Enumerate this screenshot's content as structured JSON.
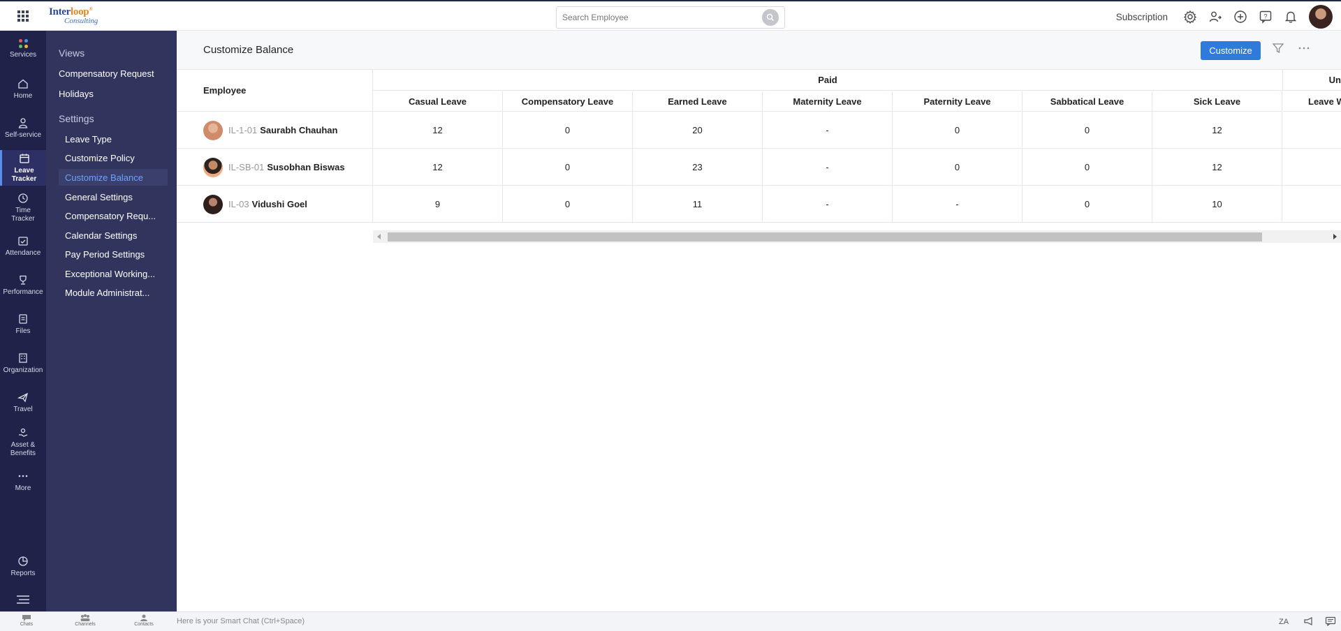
{
  "logo": {
    "line1_pre": "Inter",
    "line1_accent": "loop",
    "line1_mark": "®",
    "line2": "Consulting"
  },
  "search": {
    "placeholder": "Search Employee"
  },
  "topbar": {
    "subscription": "Subscription",
    "icons": [
      "settings-icon",
      "user-switch-icon",
      "add-icon",
      "help-icon",
      "bell-icon"
    ]
  },
  "rail": {
    "items": [
      {
        "label": "Services",
        "icon": "services-icon"
      },
      {
        "label": "Home",
        "icon": "home-icon"
      },
      {
        "label": "Self-service",
        "icon": "person-icon"
      },
      {
        "label": "Leave Tracker",
        "icon": "calendar-icon",
        "active": true
      },
      {
        "label": "Time Tracker",
        "icon": "clock-icon"
      },
      {
        "label": "Attendance",
        "icon": "calendar-check-icon"
      },
      {
        "label": "Performance",
        "icon": "trophy-icon"
      },
      {
        "label": "Files",
        "icon": "files-icon"
      },
      {
        "label": "Organization",
        "icon": "building-icon"
      },
      {
        "label": "Travel",
        "icon": "plane-icon"
      },
      {
        "label": "Asset & Benefits",
        "icon": "hand-icon"
      },
      {
        "label": "More",
        "icon": "more-icon"
      },
      {
        "label": "Reports",
        "icon": "pie-chart-icon"
      }
    ]
  },
  "submenu": {
    "views": "Views",
    "compensatory_request": "Compensatory Request",
    "holidays": "Holidays",
    "settings": "Settings",
    "settings_items": [
      "Leave Type",
      "Customize Policy",
      "Customize Balance",
      "General Settings",
      "Compensatory Requ...",
      "Calendar Settings",
      "Pay Period Settings",
      "Exceptional Working...",
      "Module Administrat..."
    ]
  },
  "page": {
    "title": "Customize Balance",
    "customize_label": "Customize"
  },
  "table": {
    "employee_header": "Employee",
    "group_paid": "Paid",
    "group_unpaid": "Un",
    "columns": [
      "Casual Leave",
      "Compensatory Leave",
      "Earned Leave",
      "Maternity Leave",
      "Paternity Leave",
      "Sabbatical Leave",
      "Sick Leave",
      "Leave W"
    ],
    "rows": [
      {
        "id": "IL-1-01",
        "name": "Saurabh Chauhan",
        "values": [
          "12",
          "0",
          "20",
          "-",
          "0",
          "0",
          "12",
          ""
        ]
      },
      {
        "id": "IL-SB-01",
        "name": "Susobhan Biswas",
        "values": [
          "12",
          "0",
          "23",
          "-",
          "0",
          "0",
          "12",
          ""
        ]
      },
      {
        "id": "IL-03",
        "name": "Vidushi Goel",
        "values": [
          "9",
          "0",
          "11",
          "-",
          "-",
          "0",
          "10",
          ""
        ]
      }
    ]
  },
  "bottombar": {
    "chats": "Chats",
    "channels": "Channels",
    "contacts": "Contacts",
    "smart_chat": "Here is your Smart Chat (Ctrl+Space)"
  },
  "colors": {
    "rail_bg": "#20224a",
    "submenu_bg": "#31345c",
    "accent": "#2f7bdc",
    "active_link": "#6aa3ff"
  }
}
